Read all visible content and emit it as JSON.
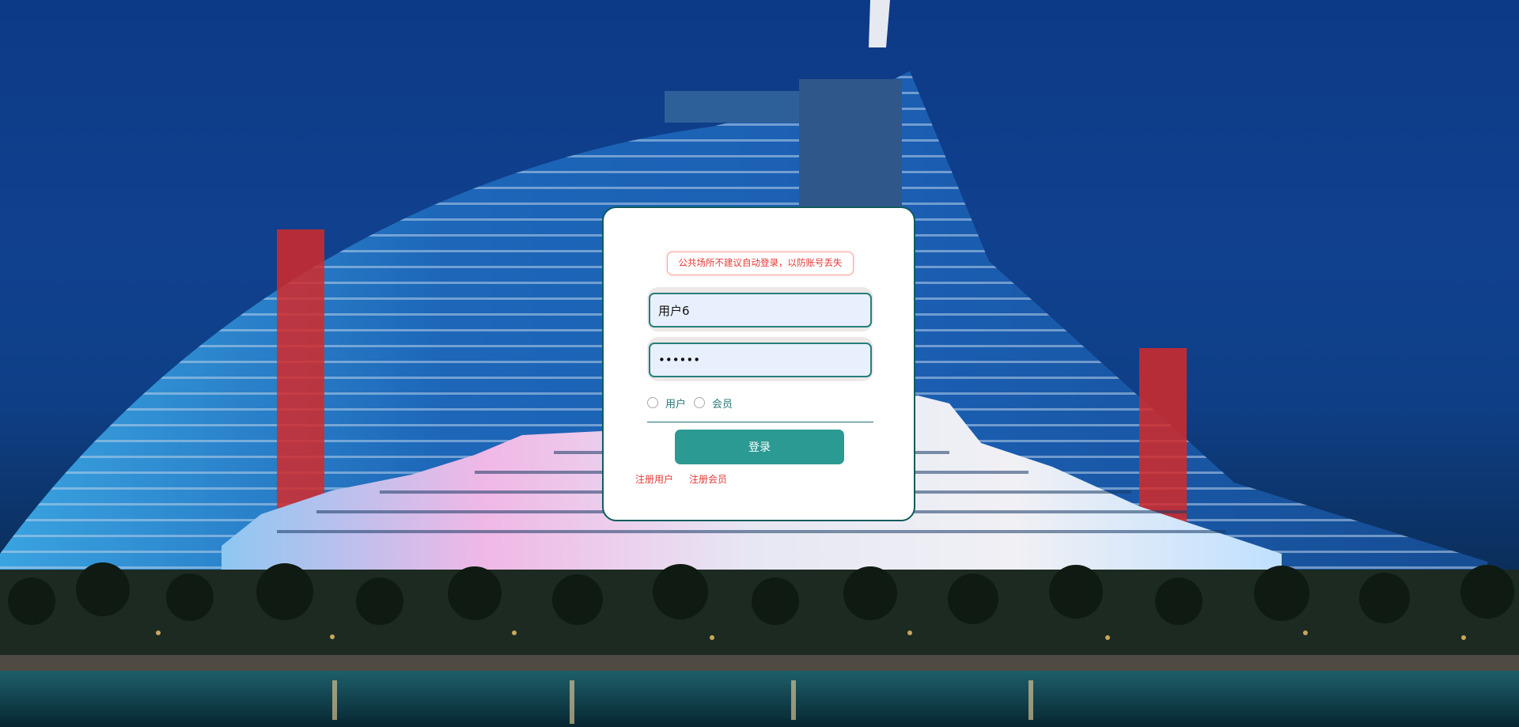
{
  "login": {
    "notice": "公共场所不建议自动登录，以防账号丢失",
    "username_value": "用户6",
    "password_value": "••••••",
    "roles": [
      "用户",
      "会员"
    ],
    "login_button": "登录",
    "links": [
      "注册用户",
      "注册会员"
    ]
  },
  "colors": {
    "accent": "#2a9a92",
    "border": "#0f5c5e",
    "warning": "#e53935",
    "input_bg": "#e8f0fe"
  },
  "icons": [
    "radio-unchecked-icon"
  ]
}
